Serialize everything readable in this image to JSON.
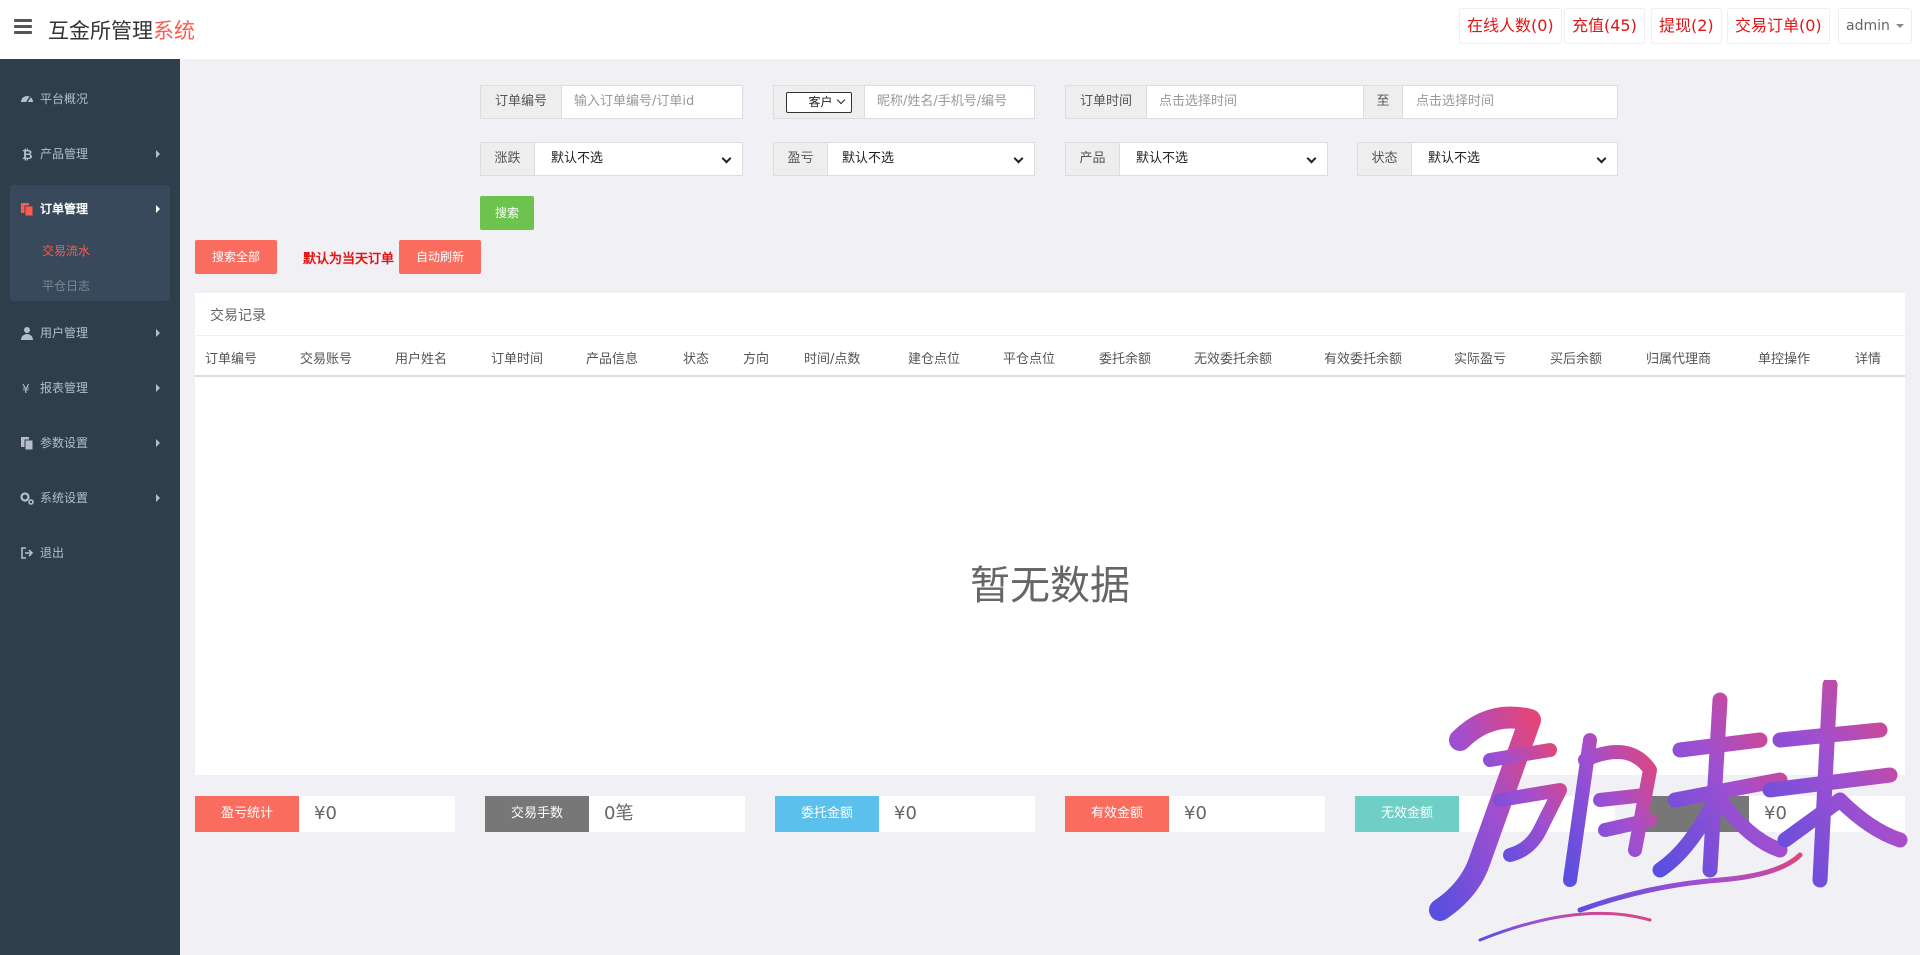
{
  "header": {
    "title_main": "互金所管理",
    "title_accent": "系统",
    "online": "在线人数(0)",
    "recharge": "充值(45)",
    "withdraw": "提现(2)",
    "orders": "交易订单(0)",
    "user": "admin"
  },
  "sidebar": {
    "items": [
      {
        "label": "平台概况",
        "icon": "dashboard-icon"
      },
      {
        "label": "产品管理",
        "icon": "bitcoin-icon"
      },
      {
        "label": "订单管理",
        "icon": "copy-icon"
      },
      {
        "label": "用户管理",
        "icon": "user-icon"
      },
      {
        "label": "报表管理",
        "icon": "yen-icon"
      },
      {
        "label": "参数设置",
        "icon": "copy-icon"
      },
      {
        "label": "系统设置",
        "icon": "gears-icon"
      },
      {
        "label": "退出",
        "icon": "sign-out-icon"
      }
    ],
    "sub": [
      "交易流水",
      "平仓日志"
    ]
  },
  "filters": {
    "order_no_label": "订单编号",
    "order_no_placeholder": "输入订单编号/订单id",
    "client_select": "客户",
    "client_placeholder": "昵称/姓名/手机号/编号",
    "time_label": "订单时间",
    "time_start_placeholder": "点击选择时间",
    "to_label": "至",
    "time_end_placeholder": "点击选择时间",
    "rise_fall_label": "涨跌",
    "profit_label": "盈亏",
    "product_label": "产品",
    "status_label": "状态",
    "default_option": "默认不选",
    "search_btn": "搜索"
  },
  "actions": {
    "search_all": "搜索全部",
    "note": "默认为当天订单",
    "auto_refresh": "自动刷新"
  },
  "table": {
    "title": "交易记录",
    "columns": [
      "订单编号",
      "交易账号",
      "用户姓名",
      "订单时间",
      "产品信息",
      "状态",
      "方向",
      "时间/点数",
      "建仓点位",
      "平仓点位",
      "委托余额",
      "无效委托余额",
      "有效委托余额",
      "实际盈亏",
      "买后余额",
      "归属代理商",
      "单控操作",
      "详情"
    ],
    "empty": "暂无数据"
  },
  "stats": [
    {
      "label": "盈亏统计",
      "value": "¥0",
      "color": "#fa6d5e"
    },
    {
      "label": "交易手数",
      "value": "0笔",
      "color": "#777777"
    },
    {
      "label": "委托金额",
      "value": "¥0",
      "color": "#5bc0eb"
    },
    {
      "label": "有效金额",
      "value": "¥0",
      "color": "#fa6d5e"
    },
    {
      "label": "无效金额",
      "value": "",
      "color": "#6fcfc6"
    },
    {
      "label": "",
      "value": "¥0",
      "color": "#777777"
    }
  ],
  "colors": {
    "accent": "#fa5c4f",
    "danger": "#e21515",
    "success": "#6cc34e",
    "sidebar": "#2f3e4b"
  }
}
